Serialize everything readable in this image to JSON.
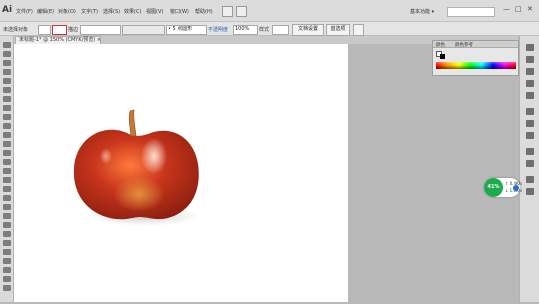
{
  "app": {
    "logo": "Ai"
  },
  "menubar": {
    "items": [
      "文件(F)",
      "编辑(E)",
      "对象(O)",
      "文字(T)",
      "选择(S)",
      "效果(C)",
      "视图(V)",
      "窗口(W)",
      "帮助(H)"
    ],
    "workspace": "基本功能 ▾",
    "window_controls": [
      "—",
      "□",
      "✕"
    ]
  },
  "controlbar": {
    "selection_label": "未选择对象",
    "stroke_label": "描边",
    "brush_value": "• 5 点圆形",
    "opacity_label": "不透明度",
    "opacity_value": "100%",
    "style_label": "样式",
    "doc_setup_button": "文档设置",
    "preferences_button": "首选项"
  },
  "document": {
    "tab_title": "未标题-1* @ 150% (CMYK/预览)",
    "tab_close": "×"
  },
  "color_panel": {
    "tabs": [
      "颜色",
      "颜色参考"
    ],
    "fill": "#ffffff",
    "stroke": "#000000"
  },
  "status_widget": {
    "percent": "41%",
    "up_rate": "↑ 0.4K/s",
    "down_rate": "↓ 1.0K/s"
  },
  "colors": {
    "apple_body": "#c8351c",
    "apple_highlight": "#ff7a3c",
    "apple_yellow": "#e08a2a",
    "stem": "#c07a3a",
    "status_green": "#1eaa4e"
  }
}
